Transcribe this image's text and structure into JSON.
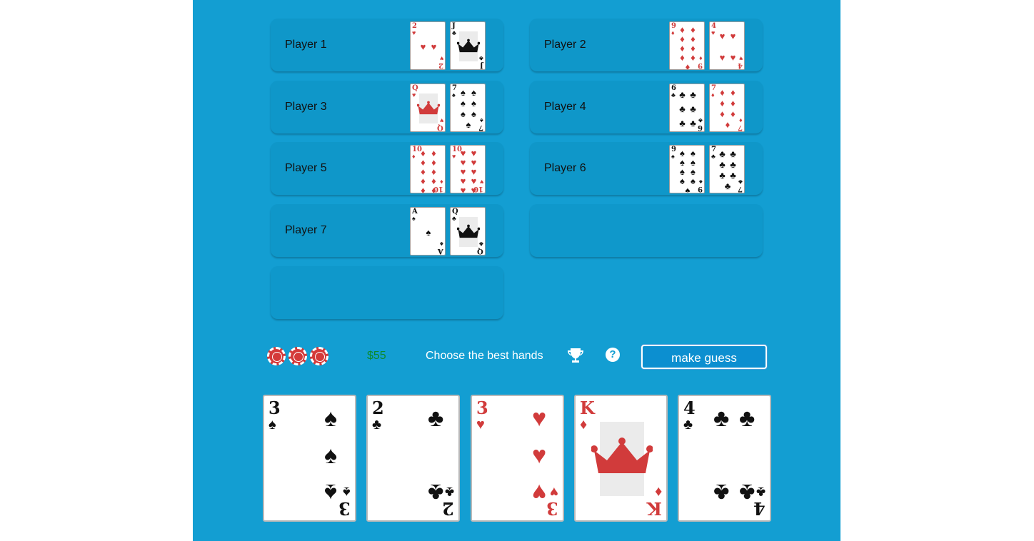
{
  "players": [
    {
      "name": "Player 1",
      "cards": [
        {
          "rank": "2",
          "suit": "♥",
          "color": "red"
        },
        {
          "rank": "J",
          "suit": "♣",
          "color": "black"
        }
      ]
    },
    {
      "name": "Player 2",
      "cards": [
        {
          "rank": "9",
          "suit": "♦",
          "color": "red"
        },
        {
          "rank": "4",
          "suit": "♥",
          "color": "red"
        }
      ]
    },
    {
      "name": "Player 3",
      "cards": [
        {
          "rank": "Q",
          "suit": "♥",
          "color": "red"
        },
        {
          "rank": "7",
          "suit": "♠",
          "color": "black"
        }
      ]
    },
    {
      "name": "Player 4",
      "cards": [
        {
          "rank": "6",
          "suit": "♣",
          "color": "black"
        },
        {
          "rank": "7",
          "suit": "♦",
          "color": "red"
        }
      ]
    },
    {
      "name": "Player 5",
      "cards": [
        {
          "rank": "10",
          "suit": "♦",
          "color": "red"
        },
        {
          "rank": "10",
          "suit": "♥",
          "color": "red"
        }
      ]
    },
    {
      "name": "Player 6",
      "cards": [
        {
          "rank": "9",
          "suit": "♠",
          "color": "black"
        },
        {
          "rank": "7",
          "suit": "♣",
          "color": "black"
        }
      ]
    },
    {
      "name": "Player 7",
      "cards": [
        {
          "rank": "A",
          "suit": "♠",
          "color": "black"
        },
        {
          "rank": "Q",
          "suit": "♣",
          "color": "black"
        }
      ]
    }
  ],
  "status": {
    "chips_count": 3,
    "money": "$55",
    "prompt": "Choose the best hands",
    "trophy_icon": "trophy-icon",
    "help_icon": "question-circle-icon",
    "help_glyph": "?",
    "guess_button": "make guess"
  },
  "board": [
    {
      "rank": "3",
      "suit": "♠",
      "color": "black"
    },
    {
      "rank": "2",
      "suit": "♣",
      "color": "black"
    },
    {
      "rank": "3",
      "suit": "♥",
      "color": "red"
    },
    {
      "rank": "K",
      "suit": "♦",
      "color": "red"
    },
    {
      "rank": "4",
      "suit": "♣",
      "color": "black"
    }
  ],
  "colors": {
    "table": "#139ed2",
    "slot": "#0f97c9",
    "red_suit": "#d13b3b",
    "money": "#0c8a2a",
    "chip": "#d43a3a"
  }
}
